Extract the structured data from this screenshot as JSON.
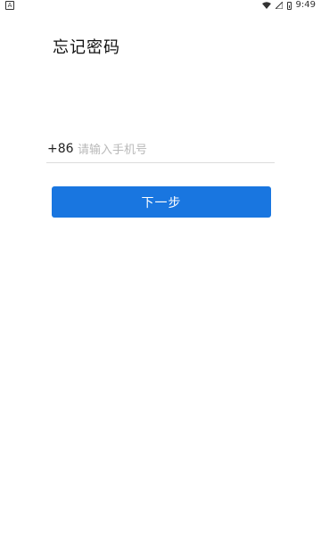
{
  "status_bar": {
    "left_icon": "A",
    "time": "9:49",
    "icons": [
      "wifi-icon",
      "signal-icon",
      "battery-icon"
    ]
  },
  "page": {
    "title": "忘记密码"
  },
  "phone": {
    "country_code": "+86",
    "placeholder": "请输入手机号",
    "value": ""
  },
  "actions": {
    "next_label": "下一步"
  },
  "colors": {
    "primary": "#1976e0",
    "divider": "#dcdcdc",
    "placeholder": "#b9b9b9"
  }
}
